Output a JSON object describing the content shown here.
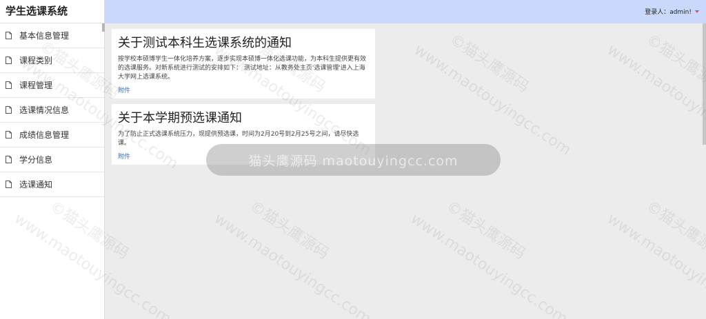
{
  "app": {
    "title": "学生选课系统"
  },
  "header": {
    "user_label": "登录人：admin!"
  },
  "sidebar": {
    "items": [
      {
        "label": "基本信息管理",
        "icon": "file-icon"
      },
      {
        "label": "课程类别",
        "icon": "file-icon"
      },
      {
        "label": "课程管理",
        "icon": "file-icon"
      },
      {
        "label": "选课情况信息",
        "icon": "file-icon"
      },
      {
        "label": "成绩信息管理",
        "icon": "file-icon"
      },
      {
        "label": "学分信息",
        "icon": "file-icon"
      },
      {
        "label": "选课通知",
        "icon": "file-icon"
      }
    ]
  },
  "notices": [
    {
      "title": "关于测试本科生选课系统的通知",
      "body": "按学校本硕博学生一体化培养方案，逐步实现本硕博一体化选课功能，为本科生提供更有效的选课服务。对新系统进行测试的安排如下： 测试地址：从教务处主页'选课管理'进入上海大学网上选课系统。",
      "link": "附件"
    },
    {
      "title": "关于本学期预选课通知",
      "body": "为了防止正式选课系统压力，现提供预选课，时间为2月20号到2月25号之间，请尽快选课。",
      "link": "附件"
    }
  ],
  "watermark": {
    "toast": "猫头鹰源码 maotouyingcc.com",
    "line1": "©猫头鹰源码",
    "line2": "www.maotouyingcc.com"
  },
  "colors": {
    "header_bg": "#c9d8fb",
    "page_bg": "#ececec",
    "link": "#2a6fc9",
    "caret": "#d9534f"
  }
}
